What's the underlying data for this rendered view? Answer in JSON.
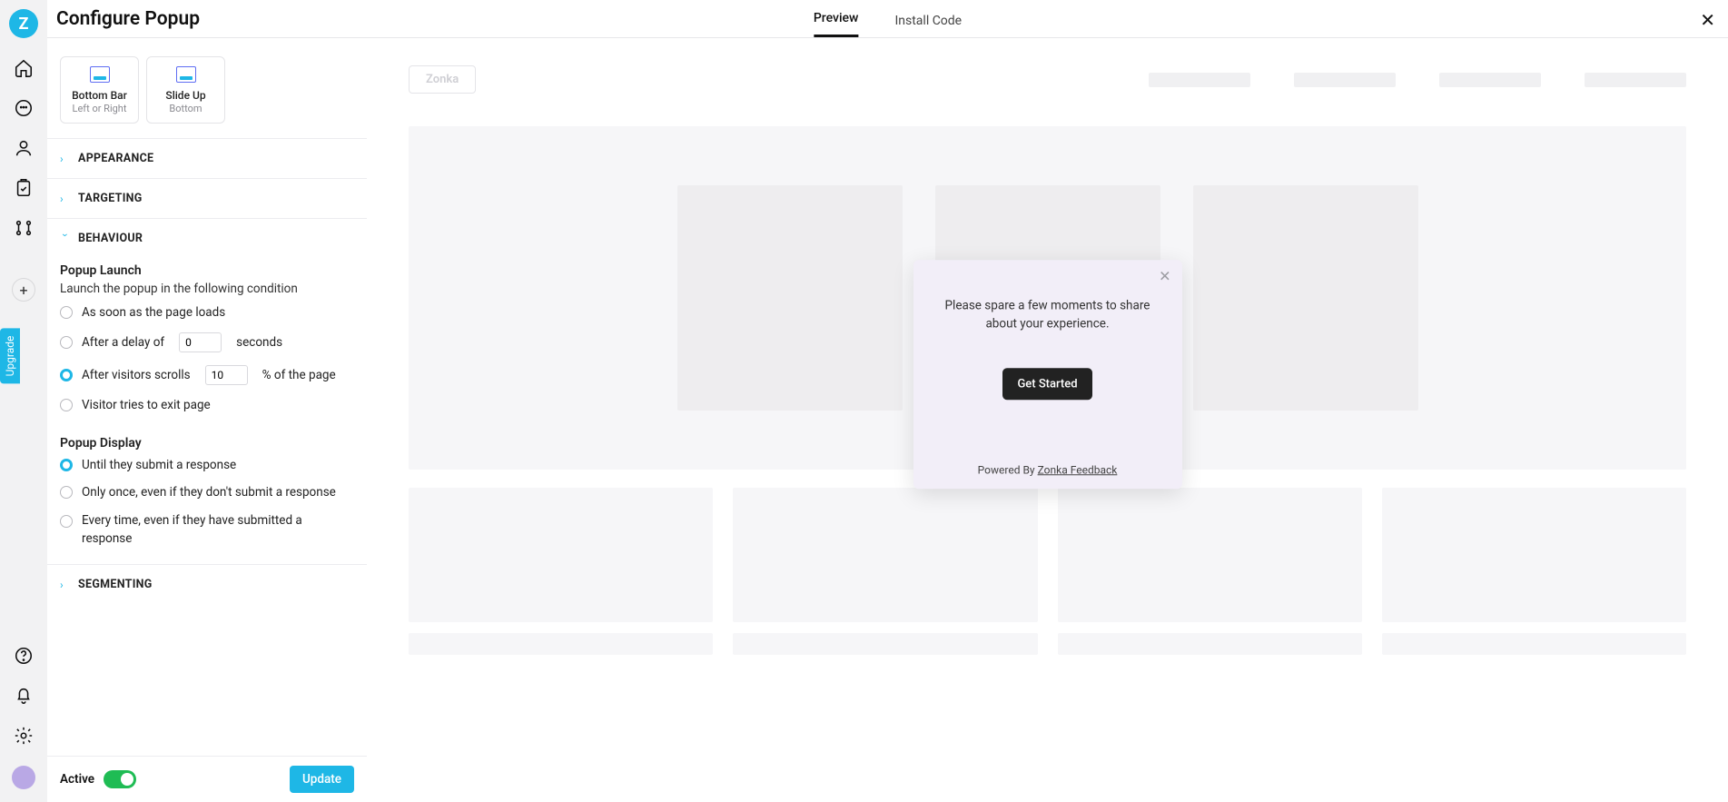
{
  "brand": "Z",
  "upgrade_label": "Upgrade",
  "header": {
    "title": "Configure Popup",
    "tabs": {
      "preview": "Preview",
      "install": "Install Code"
    }
  },
  "type_cards": {
    "bottom_bar": {
      "label": "Bottom Bar",
      "sub": "Left or Right"
    },
    "slide_up": {
      "label": "Slide Up",
      "sub": "Bottom"
    }
  },
  "sections": {
    "appearance": "APPEARANCE",
    "targeting": "TARGETING",
    "behaviour": "BEHAVIOUR",
    "segmenting": "SEGMENTING"
  },
  "behaviour": {
    "launch_heading": "Popup Launch",
    "launch_desc": "Launch the popup in the following condition",
    "opt_pageload": "As soon as the page loads",
    "opt_delay_prefix": "After a delay of",
    "opt_delay_value": "0",
    "opt_delay_suffix": "seconds",
    "opt_scroll_prefix": "After visitors scrolls",
    "opt_scroll_value": "10",
    "opt_scroll_suffix": "% of the page",
    "opt_exit": "Visitor tries to exit page",
    "display_heading": "Popup Display",
    "opt_until_submit": "Until they submit a response",
    "opt_only_once": "Only once, even if they don't submit a response",
    "opt_every_time": "Every time, even if they have submitted a response"
  },
  "footer": {
    "active_label": "Active",
    "update_label": "Update"
  },
  "preview": {
    "logo_text": "Zonka",
    "popup_text": "Please spare a few moments to share about your experience.",
    "popup_cta": "Get Started",
    "powered_prefix": "Powered By ",
    "powered_link": "Zonka Feedback"
  }
}
